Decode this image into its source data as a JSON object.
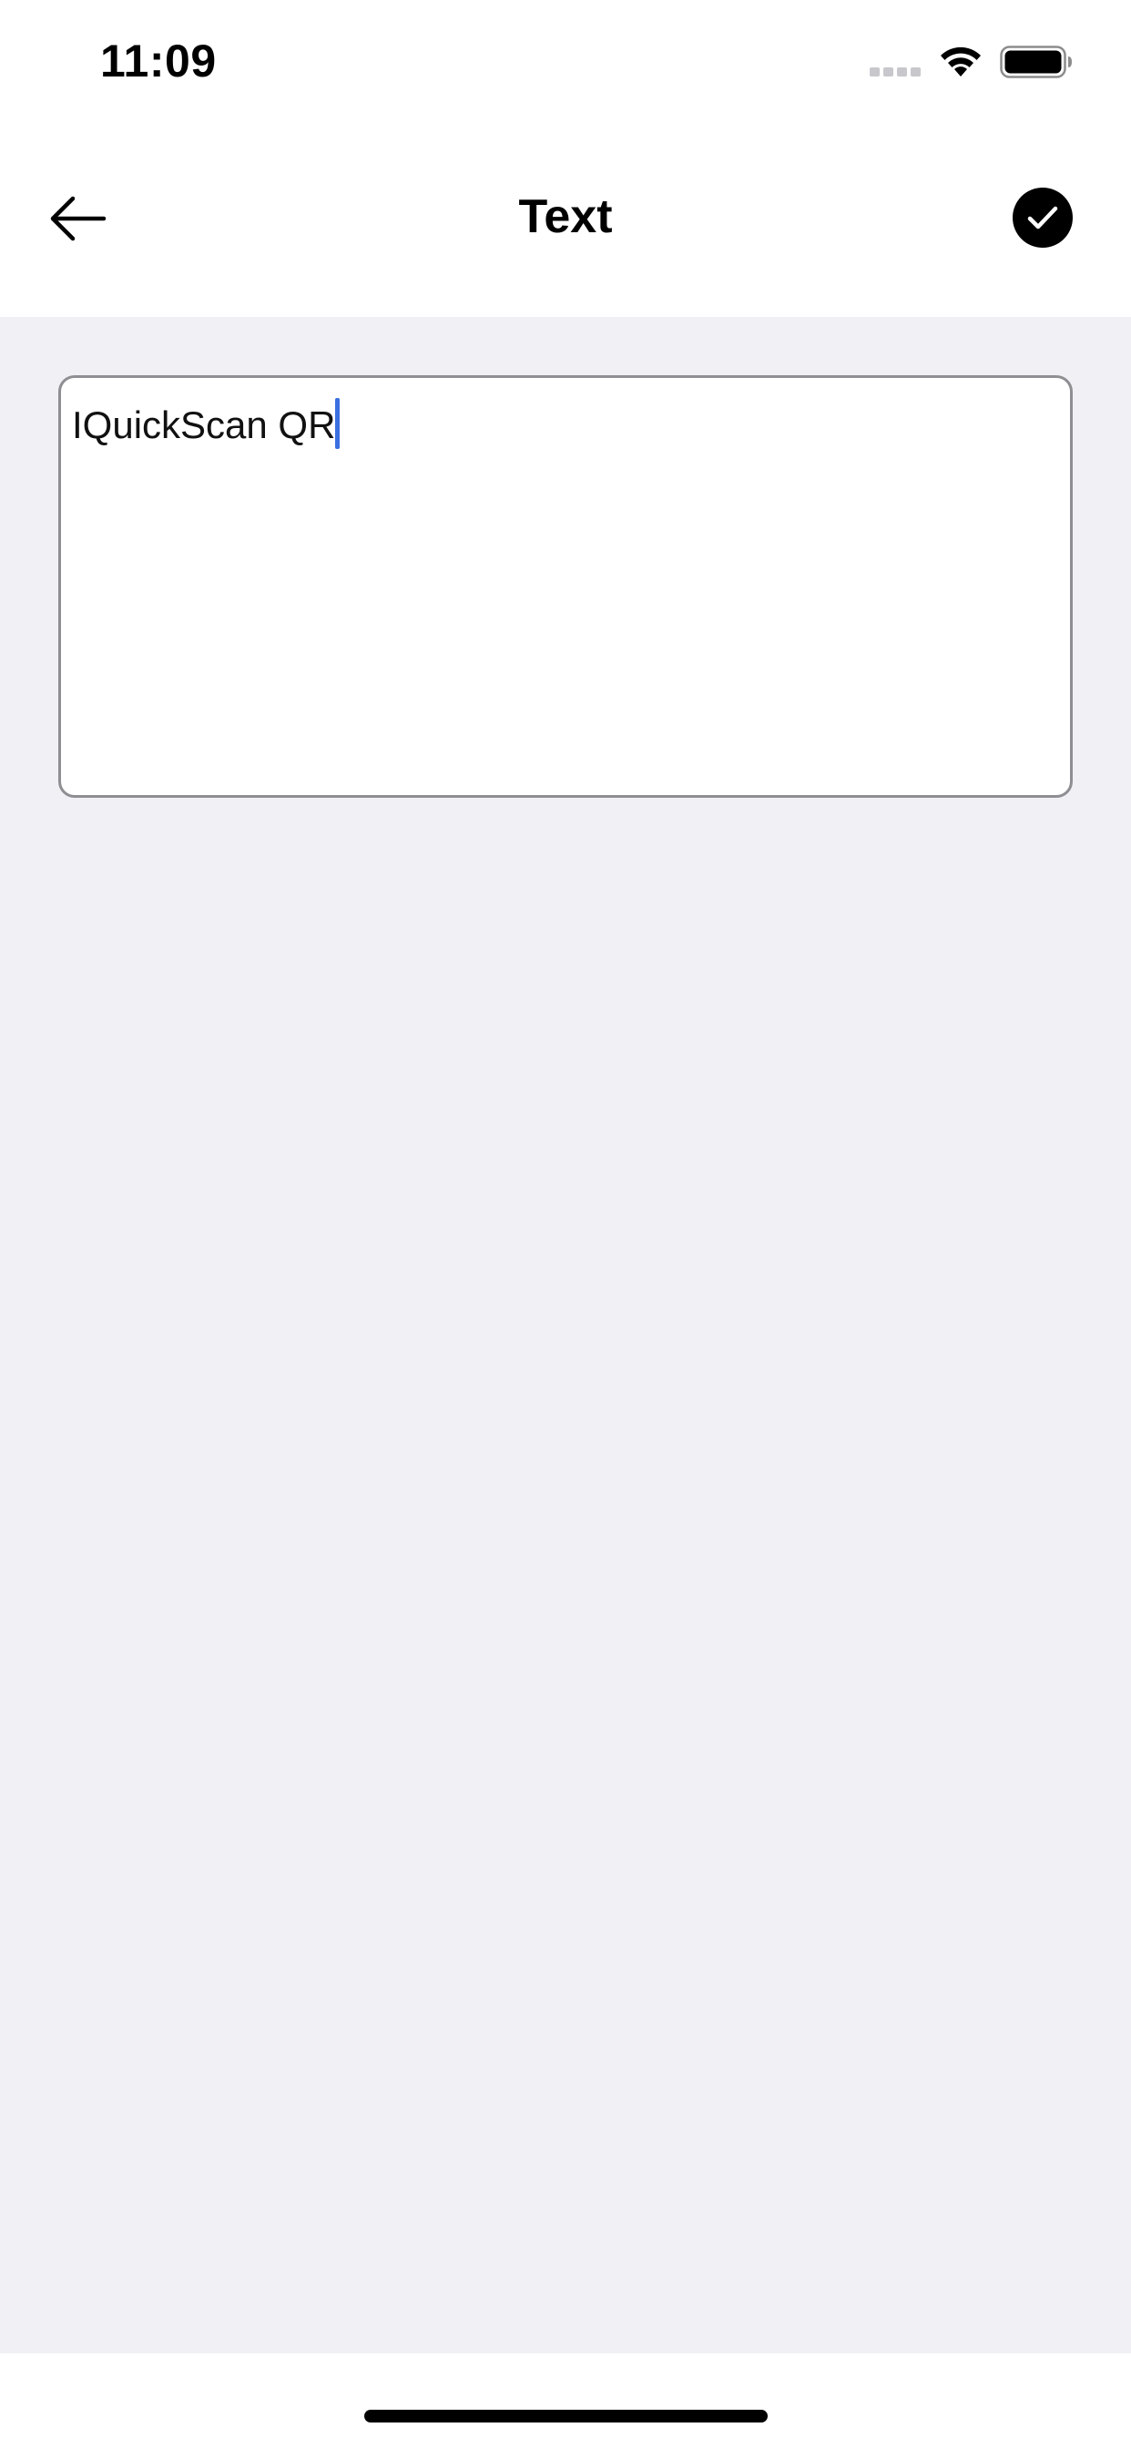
{
  "status_bar": {
    "time": "11:09",
    "icons": [
      "cellular-signal-icon",
      "wifi-icon",
      "battery-icon"
    ]
  },
  "nav": {
    "title": "Text",
    "back_icon": "arrow-left-icon",
    "done_icon": "checkmark-circle-icon"
  },
  "editor": {
    "value": "IQuickScan QR",
    "caret_color": "#3a6fe0"
  },
  "colors": {
    "background": "#f1f0f5",
    "surface": "#ffffff",
    "text": "#000000",
    "border": "#8e8e93"
  }
}
